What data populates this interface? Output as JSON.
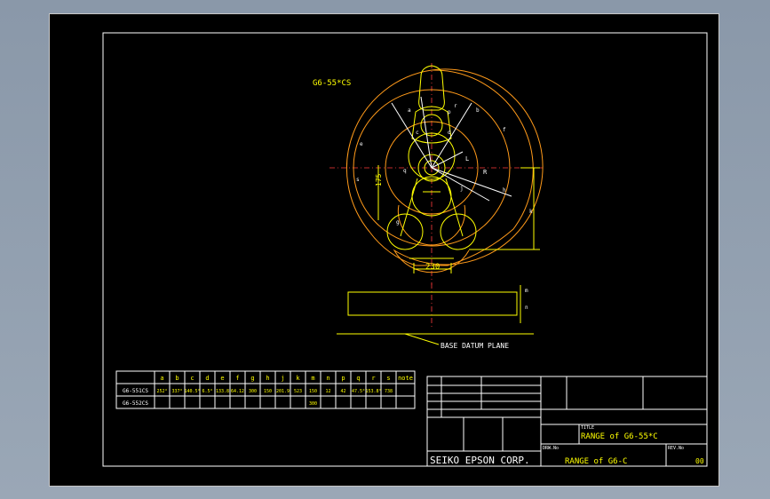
{
  "drawing": {
    "model_label": "G6-55*CS",
    "dim_bottom": "230",
    "dim_left": "175",
    "arc_labels": [
      "a",
      "b",
      "c",
      "d",
      "e",
      "f",
      "g",
      "h",
      "j",
      "k",
      "m",
      "n",
      "p",
      "q",
      "r",
      "s",
      "R",
      "L"
    ],
    "datum_label": "BASE DATUM PLANE"
  },
  "spec_table": {
    "headers": [
      "a",
      "b",
      "c",
      "d",
      "e",
      "f",
      "g",
      "h",
      "j",
      "k",
      "m",
      "n",
      "p",
      "q",
      "r",
      "s",
      "note"
    ],
    "rows": [
      {
        "name": "G6-551CS",
        "cells": [
          "252°",
          "337°",
          "140.5°",
          "6.5°",
          "133.8",
          "64.12",
          "300",
          "150",
          "201.9",
          "523",
          "150",
          "12",
          "42",
          "47.5°",
          "153.8°",
          "738",
          ""
        ]
      },
      {
        "name": "G6-552CS",
        "cells": [
          "",
          "",
          "",
          "",
          "",
          "",
          "",
          "",
          "",
          "",
          "300",
          "",
          "",
          "",
          "",
          "",
          ""
        ]
      }
    ]
  },
  "title_block": {
    "company": "SEIKO EPSON CORP.",
    "title_label": "TITLE",
    "title": "RANGE of G6-55*C",
    "drw_label": "DRW.No",
    "drw": "RANGE of G6-C",
    "rev_label": "REV.No",
    "rev": "00"
  },
  "colors": {
    "background": "#000000",
    "window": "#8a98a9",
    "frame": "#ffffff",
    "geometry": "#ffff00",
    "range": "#ff9a1a",
    "centerline": "#ff3b3b"
  }
}
